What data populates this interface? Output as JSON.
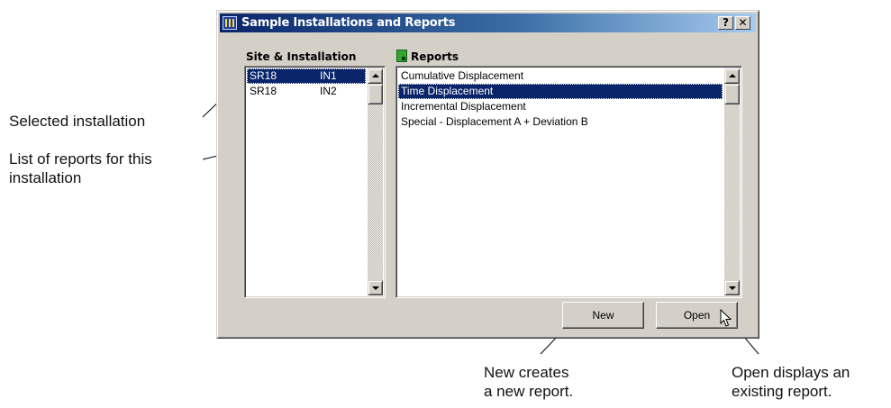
{
  "dialog": {
    "title": "Sample Installations and Reports",
    "help_button": "?",
    "close_button": "✕"
  },
  "installations": {
    "label": "Site & Installation",
    "rows": [
      {
        "site": "SR18",
        "installation": "IN1",
        "selected": true
      },
      {
        "site": "SR18",
        "installation": "IN2",
        "selected": false
      }
    ]
  },
  "reports": {
    "label": "Reports",
    "items": [
      {
        "name": "Cumulative Displacement",
        "selected": false
      },
      {
        "name": "Time Displacement",
        "selected": true
      },
      {
        "name": "Incremental Displacement",
        "selected": false
      },
      {
        "name": "Special - Displacement A + Deviation B",
        "selected": false
      }
    ]
  },
  "buttons": {
    "new": "New",
    "open": "Open"
  },
  "callouts": {
    "selected_installation": "Selected installation",
    "report_list_line1": "List of reports for this",
    "report_list_line2": "installation",
    "new_line1": "New creates",
    "new_line2": "a new report.",
    "open_line1": "Open displays an",
    "open_line2": "existing report."
  },
  "colors": {
    "selection": "#0a246a",
    "window_face": "#d4d0c8",
    "report_icon": "#2fa82f"
  }
}
